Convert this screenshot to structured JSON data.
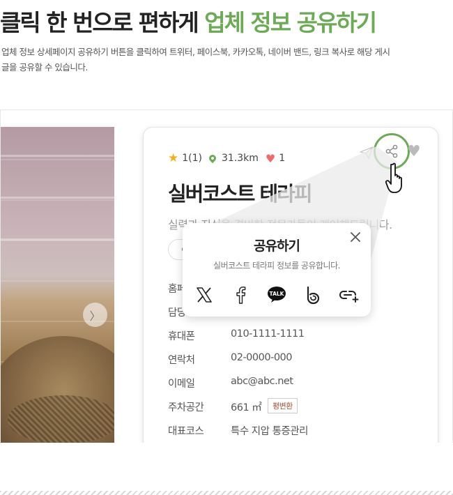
{
  "header": {
    "title_plain": "클릭 한 번으로 편하게",
    "title_accent": "업체 정보 공유하기",
    "description": "업체 정보 상세페이지 공유하기 버튼을 클릭하여 트위터, 페이스북, 카카오톡, 네이버 밴드, 링크 복사로 해당 게시글을 공유할 수 있습니다."
  },
  "gallery": {
    "next_label": "〉"
  },
  "place": {
    "rating": "1(1)",
    "distance": "31.3km",
    "likes": "1",
    "title": "실버코스트 테라피",
    "subtitle": "실력과 지식을 겸비한 전문가들이 케어해드립니다.",
    "pill_label": "안",
    "info": [
      {
        "label": "홈페",
        "value": ""
      },
      {
        "label": "담당",
        "value": ""
      },
      {
        "label": "휴대폰",
        "value": "010-1111-1111"
      },
      {
        "label": "연락처",
        "value": "02-0000-000"
      },
      {
        "label": "이메일",
        "value": "abc@abc.net"
      },
      {
        "label": "주차공간",
        "value": "661 ㎡"
      },
      {
        "label": "대표코스",
        "value": "특수 지압 통증관리"
      }
    ],
    "parking_tag": "평변환"
  },
  "share_popup": {
    "title": "공유하기",
    "subtitle": "실버코스트 테라피 정보를 공유합니다.",
    "kakao_badge": "TALK",
    "targets": [
      "x-icon",
      "facebook-icon",
      "kakaotalk-icon",
      "band-icon",
      "link-copy-icon"
    ]
  },
  "colors": {
    "accent": "#6aab54",
    "star": "#f2b01e",
    "heart": "#f06a6a"
  }
}
